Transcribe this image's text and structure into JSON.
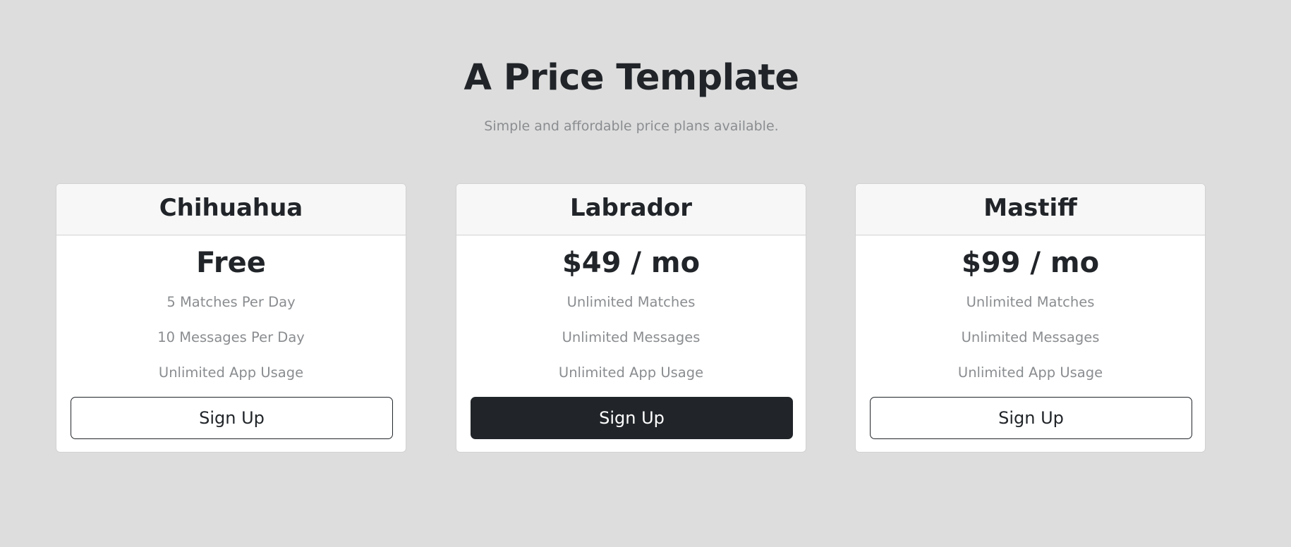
{
  "header": {
    "title": "A Price Template",
    "subtitle": "Simple and affordable price plans available."
  },
  "plans": [
    {
      "name": "Chihuahua",
      "price": "Free",
      "features": [
        "5 Matches Per Day",
        "10 Messages Per Day",
        "Unlimited App Usage"
      ],
      "cta": "Sign Up",
      "cta_style": "outline"
    },
    {
      "name": "Labrador",
      "price": "$49 / mo",
      "features": [
        "Unlimited Matches",
        "Unlimited Messages",
        "Unlimited App Usage"
      ],
      "cta": "Sign Up",
      "cta_style": "solid"
    },
    {
      "name": "Mastiff",
      "price": "$99 / mo",
      "features": [
        "Unlimited Matches",
        "Unlimited Messages",
        "Unlimited App Usage"
      ],
      "cta": "Sign Up",
      "cta_style": "outline"
    }
  ],
  "colors": {
    "background": "#dddddd",
    "text_dark": "#212529",
    "text_muted": "#8a8d90",
    "card_header": "#f7f7f7"
  }
}
